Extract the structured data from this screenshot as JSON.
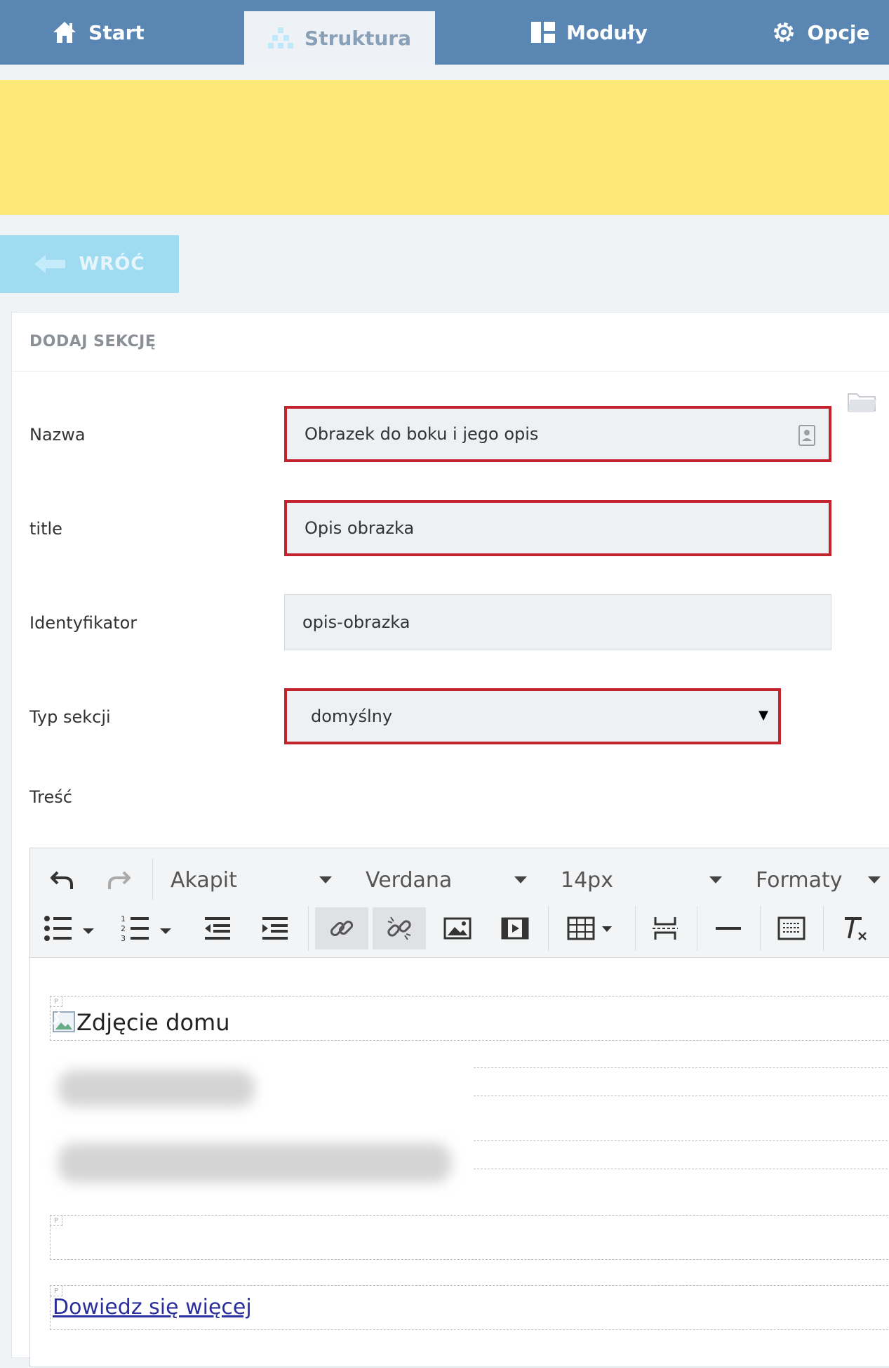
{
  "nav": {
    "tabs": [
      {
        "label": "Start",
        "icon": "home-icon"
      },
      {
        "label": "Struktura",
        "icon": "structure-icon",
        "active": true
      },
      {
        "label": "Moduły",
        "icon": "modules-icon"
      },
      {
        "label": "Opcje",
        "icon": "gear-icon"
      }
    ]
  },
  "back": {
    "label": "WRÓĆ"
  },
  "card": {
    "title": "DODAJ SEKCJĘ"
  },
  "form": {
    "nazwa": {
      "label": "Nazwa",
      "value": "Obrazek do boku i jego opis"
    },
    "title": {
      "label": "title",
      "value": "Opis obrazka"
    },
    "identyfikator": {
      "label": "Identyfikator",
      "value": "opis-obrazka"
    },
    "typ": {
      "label": "Typ sekcji",
      "value": "domyślny"
    },
    "tresc": {
      "label": "Treść"
    }
  },
  "editor": {
    "toolbar": {
      "block_format": "Akapit",
      "font_family": "Verdana",
      "font_size": "14px",
      "formats": "Formaty"
    },
    "content": {
      "image_alt": "Zdjęcie domu",
      "paragraph_marker": "P",
      "link_text": "Dowiedz się więcej"
    }
  },
  "colors": {
    "nav_bg": "#5a86b3",
    "banner": "#fde977",
    "back_button": "#9fdcf2",
    "highlight_border": "#c3232d",
    "link": "#2b2f9b"
  }
}
